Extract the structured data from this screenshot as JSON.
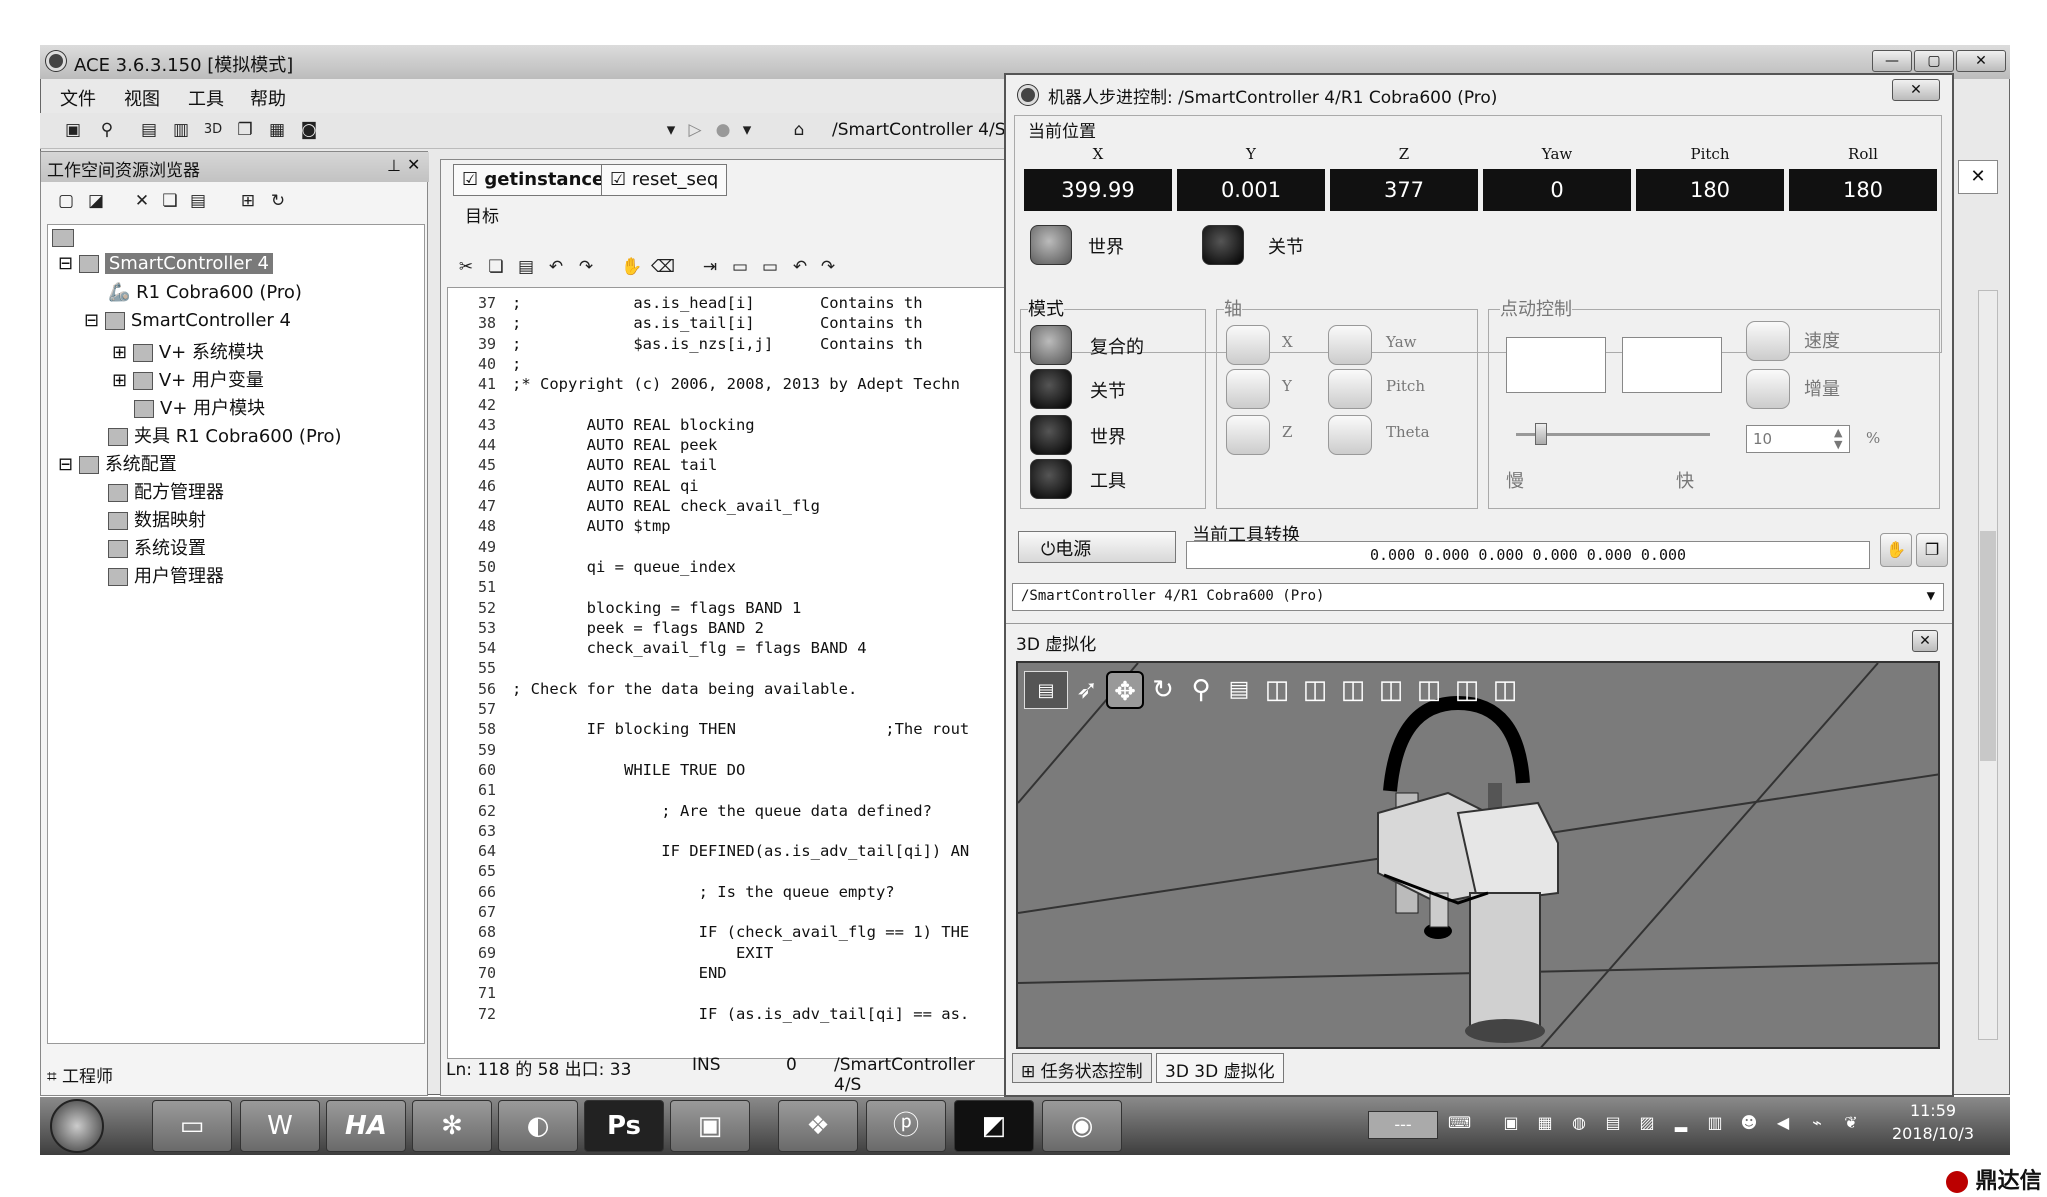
{
  "app": {
    "title": "ACE 3.6.3.150 [模拟模式]",
    "menu": [
      "文件",
      "视图",
      "工具",
      "帮助"
    ],
    "address": "/SmartController 4/S"
  },
  "workspace": {
    "title": "工作空间资源浏览器",
    "tree": [
      {
        "label": "SmartController 4",
        "selected": true
      },
      {
        "label": "R1 Cobra600 (Pro)"
      },
      {
        "label": "SmartController 4"
      },
      {
        "label": "V+ 系统模块"
      },
      {
        "label": "V+ 用户变量"
      },
      {
        "label": "V+ 用户模块"
      },
      {
        "label": "夹具 R1 Cobra600 (Pro)"
      },
      {
        "label": "系统配置"
      },
      {
        "label": "配方管理器"
      },
      {
        "label": "数据映射"
      },
      {
        "label": "系统设置"
      },
      {
        "label": "用户管理器"
      }
    ],
    "footer": "工程师"
  },
  "editor": {
    "tabs": [
      "getinstance",
      "reset_seq"
    ],
    "target_label": "目标",
    "lines": [
      {
        "n": "37",
        "code": ";            as.is_head[i]       Contains th"
      },
      {
        "n": "38",
        "code": ";            as.is_tail[i]       Contains th"
      },
      {
        "n": "39",
        "code": ";            $as.is_nzs[i,j]     Contains th"
      },
      {
        "n": "40",
        "code": ";"
      },
      {
        "n": "41",
        "code": ";* Copyright (c) 2006, 2008, 2013 by Adept Techn"
      },
      {
        "n": "42",
        "code": ""
      },
      {
        "n": "43",
        "code": "        AUTO REAL blocking"
      },
      {
        "n": "44",
        "code": "        AUTO REAL peek"
      },
      {
        "n": "45",
        "code": "        AUTO REAL tail"
      },
      {
        "n": "46",
        "code": "        AUTO REAL qi"
      },
      {
        "n": "47",
        "code": "        AUTO REAL check_avail_flg"
      },
      {
        "n": "48",
        "code": "        AUTO $tmp"
      },
      {
        "n": "49",
        "code": ""
      },
      {
        "n": "50",
        "code": "        qi = queue_index"
      },
      {
        "n": "51",
        "code": ""
      },
      {
        "n": "52",
        "code": "        blocking = flags BAND 1"
      },
      {
        "n": "53",
        "code": "        peek = flags BAND 2"
      },
      {
        "n": "54",
        "code": "        check_avail_flg = flags BAND 4"
      },
      {
        "n": "55",
        "code": ""
      },
      {
        "n": "56",
        "code": "; Check for the data being available."
      },
      {
        "n": "57",
        "code": ""
      },
      {
        "n": "58",
        "code": "        IF blocking THEN                ;The rout"
      },
      {
        "n": "59",
        "code": ""
      },
      {
        "n": "60",
        "code": "            WHILE TRUE DO"
      },
      {
        "n": "61",
        "code": ""
      },
      {
        "n": "62",
        "code": "                ; Are the queue data defined?"
      },
      {
        "n": "63",
        "code": ""
      },
      {
        "n": "64",
        "code": "                IF DEFINED(as.is_adv_tail[qi]) AN"
      },
      {
        "n": "65",
        "code": ""
      },
      {
        "n": "66",
        "code": "                    ; Is the queue empty?"
      },
      {
        "n": "67",
        "code": ""
      },
      {
        "n": "68",
        "code": "                    IF (check_avail_flg == 1) THE"
      },
      {
        "n": "69",
        "code": "                        EXIT"
      },
      {
        "n": "70",
        "code": "                    END"
      },
      {
        "n": "71",
        "code": ""
      },
      {
        "n": "72",
        "code": "                    IF (as.is_adv_tail[qi] == as."
      }
    ],
    "status": {
      "pos": "Ln: 118 的 58 出口: 33",
      "mode": "INS",
      "num": "0",
      "path": "/SmartController 4/S"
    }
  },
  "jog": {
    "title": "机器人步进控制: /SmartController 4/R1 Cobra600 (Pro)",
    "position_label": "当前位置",
    "coords": [
      {
        "name": "X",
        "value": "399.99"
      },
      {
        "name": "Y",
        "value": "0.001"
      },
      {
        "name": "Z",
        "value": "377"
      },
      {
        "name": "Yaw",
        "value": "0"
      },
      {
        "name": "Pitch",
        "value": "180"
      },
      {
        "name": "Roll",
        "value": "180"
      }
    ],
    "frame_world": "世界",
    "frame_joint": "关节",
    "mode_label": "模式",
    "modes": [
      "复合的",
      "关节",
      "世界",
      "工具"
    ],
    "axis_label": "轴",
    "axes": [
      "X",
      "Y",
      "Z",
      "Yaw",
      "Pitch",
      "Theta"
    ],
    "inch_label": "点动控制",
    "speed": "速度",
    "increment": "增量",
    "speed_value": "10",
    "percent": "%",
    "slow": "慢",
    "fast": "快",
    "power": "电源",
    "tool_label": "当前工具转换",
    "tool_value": "0.000 0.000 0.000 0.000 0.000 0.000",
    "robot_select": "/SmartController 4/R1 Cobra600 (Pro)"
  },
  "viz": {
    "title": "3D 虚拟化",
    "tabs": [
      "任务状态控制",
      "3D 3D 虚拟化"
    ]
  },
  "taskbar": {
    "buttons": [
      "",
      "",
      "W",
      "HA",
      "",
      "",
      "Ps",
      "",
      "",
      "",
      "",
      ""
    ],
    "field": "---",
    "time": "11:59",
    "date": "2018/10/3"
  },
  "watermark": "鼎达信"
}
